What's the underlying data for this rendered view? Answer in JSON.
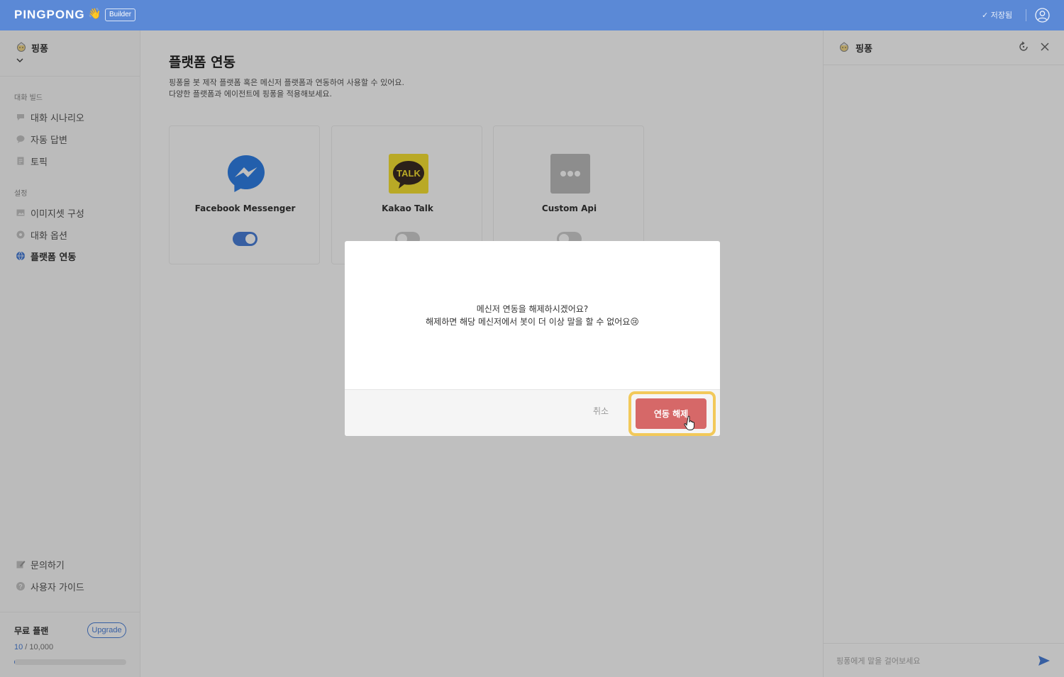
{
  "topbar": {
    "logo": "PINGPONG",
    "logo_hand": "👋",
    "badge": "Builder",
    "saved_text": "✓ 저장됨"
  },
  "sidebar": {
    "bot_name": "핑퐁",
    "section_build": "대화 빌드",
    "section_settings": "설정",
    "items_build": [
      {
        "label": "대화 시나리오"
      },
      {
        "label": "자동 답변"
      },
      {
        "label": "토픽"
      }
    ],
    "items_settings": [
      {
        "label": "이미지셋 구성"
      },
      {
        "label": "대화 옵션"
      },
      {
        "label": "플랫폼 연동"
      }
    ],
    "items_bottom": [
      {
        "label": "문의하기"
      },
      {
        "label": "사용자 가이드"
      }
    ],
    "plan_label": "무료 플랜",
    "upgrade_label": "Upgrade",
    "usage_used": "10",
    "usage_total": " / 10,000",
    "usage_fraction": 0.001
  },
  "main": {
    "title": "플랫폼 연동",
    "desc_line1": "핑퐁을 봇 제작 플랫폼 혹은 메신저 플랫폼과 연동하여 사용할 수 있어요.",
    "desc_line2": "다양한 플랫폼과 에이전트에 핑퐁을 적용해보세요.",
    "cards": [
      {
        "name": "Facebook Messenger",
        "enabled": true
      },
      {
        "name": "Kakao Talk",
        "logo_text": "TALK",
        "enabled": false
      },
      {
        "name": "Custom Api",
        "enabled": false
      }
    ]
  },
  "chat": {
    "bot_name": "핑퐁",
    "input_placeholder": "핑퐁에게 말을 걸어보세요"
  },
  "modal": {
    "line1": "메신저 연동을 해제하시겠어요?",
    "line2": "해제하면 해당 메신저에서 봇이 더 이상 말을 할 수 없어요😢",
    "cancel_label": "취소",
    "confirm_label": "연동 해제"
  },
  "colors": {
    "topbar": "#5b89d6",
    "accent": "#4a7fd8",
    "danger": "#d66868",
    "highlight": "#f2c95a",
    "kakao": "#f7e233"
  }
}
